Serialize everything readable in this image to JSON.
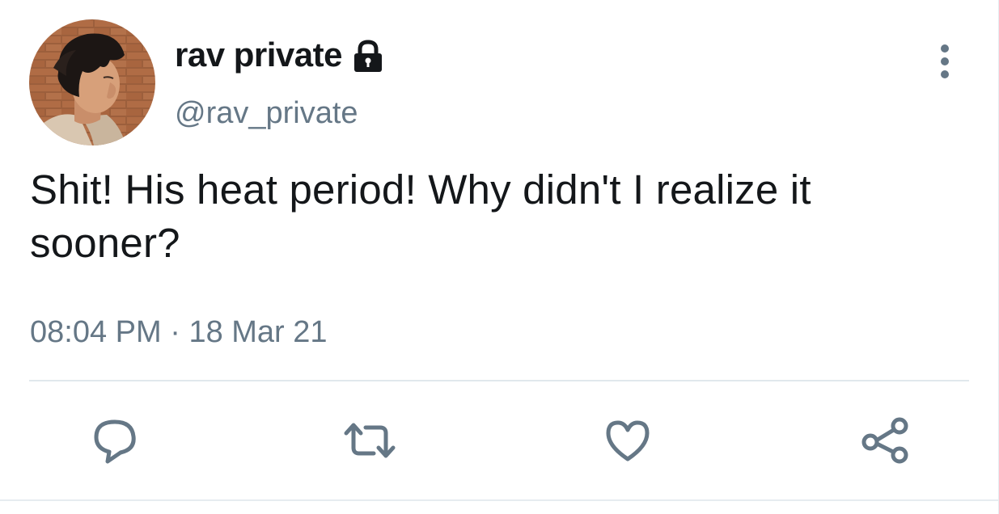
{
  "user": {
    "display_name": "rav private",
    "handle": "@rav_private",
    "protected": true
  },
  "tweet": {
    "text": "Shit! His heat period! Why didn't I realize it sooner?",
    "time": "08:04 PM",
    "separator": "·",
    "date": "18 Mar 21"
  },
  "icons": {
    "lock": "lock-icon",
    "more": "more-vertical-icon",
    "reply": "reply-icon",
    "retweet": "retweet-icon",
    "like": "heart-icon",
    "share": "share-icon"
  },
  "colors": {
    "text_primary": "#14171a",
    "text_secondary": "#657786",
    "icon": "#657786",
    "divider": "#e1e8ed"
  }
}
